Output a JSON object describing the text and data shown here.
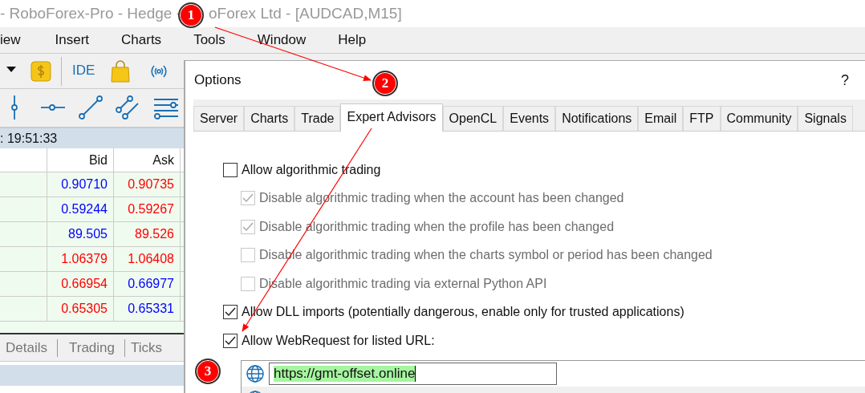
{
  "window": {
    "title_parts": [
      "- RoboForex-Pro - Hedge -",
      "oForex Ltd - [AUDCAD,M15]"
    ]
  },
  "menu": [
    "iew",
    "Insert",
    "Charts",
    "Tools",
    "Window",
    "Help"
  ],
  "toolbar": {
    "ide_label": "IDE"
  },
  "market_watch": {
    "time": ": 19:51:33",
    "columns": [
      "Bid",
      "Ask"
    ],
    "rows": [
      {
        "bid": {
          "text": "0.90710",
          "color": "#0000ff"
        },
        "ask": {
          "text": "0.90735",
          "color": "#ff0000"
        }
      },
      {
        "bid": {
          "text": "0.59244",
          "color": "#0000ff"
        },
        "ask": {
          "text": "0.59267",
          "color": "#ff0000"
        }
      },
      {
        "bid": {
          "text": "89.505",
          "color": "#0000ff"
        },
        "ask": {
          "text": "89.526",
          "color": "#ff0000"
        }
      },
      {
        "bid": {
          "text": "1.06379",
          "color": "#ff0000"
        },
        "ask": {
          "text": "1.06408",
          "color": "#ff0000"
        }
      },
      {
        "bid": {
          "text": "0.66954",
          "color": "#ff0000"
        },
        "ask": {
          "text": "0.66977",
          "color": "#0000ff"
        }
      },
      {
        "bid": {
          "text": "0.65305",
          "color": "#ff0000"
        },
        "ask": {
          "text": "0.65331",
          "color": "#0000ff"
        }
      }
    ],
    "tabs": [
      {
        "label": "Details",
        "selected": false
      },
      {
        "label": "Trading",
        "selected": false
      },
      {
        "label": "Ticks",
        "selected": false
      }
    ]
  },
  "dialog": {
    "title": "Options",
    "help": "?",
    "tabs": [
      {
        "label": "Server",
        "selected": false
      },
      {
        "label": "Charts",
        "selected": false
      },
      {
        "label": "Trade",
        "selected": false
      },
      {
        "label": "Expert Advisors",
        "selected": true
      },
      {
        "label": "OpenCL",
        "selected": false
      },
      {
        "label": "Events",
        "selected": false
      },
      {
        "label": "Notifications",
        "selected": false
      },
      {
        "label": "Email",
        "selected": false
      },
      {
        "label": "FTP",
        "selected": false
      },
      {
        "label": "Community",
        "selected": false
      },
      {
        "label": "Signals",
        "selected": false
      }
    ],
    "options": [
      {
        "label": "Allow algorithmic trading",
        "checked": false,
        "disabled": false,
        "children": [
          {
            "label": "Disable algorithmic trading when the account has been changed",
            "checked": true,
            "disabled": true
          },
          {
            "label": "Disable algorithmic trading when the profile has been changed",
            "checked": true,
            "disabled": true
          },
          {
            "label": "Disable algorithmic trading when the charts symbol or period has been changed",
            "checked": false,
            "disabled": true
          },
          {
            "label": "Disable algorithmic trading via external Python API",
            "checked": false,
            "disabled": true
          }
        ]
      },
      {
        "label": "Allow DLL imports (potentially dangerous, enable only for trusted applications)",
        "checked": true,
        "disabled": false
      },
      {
        "label": "Allow WebRequest for listed URL:",
        "checked": true,
        "disabled": false
      }
    ],
    "url_list": {
      "editing_value": "https://gmt-offset.online"
    }
  },
  "annotations": [
    {
      "number": "1"
    },
    {
      "number": "2"
    },
    {
      "number": "3"
    }
  ]
}
